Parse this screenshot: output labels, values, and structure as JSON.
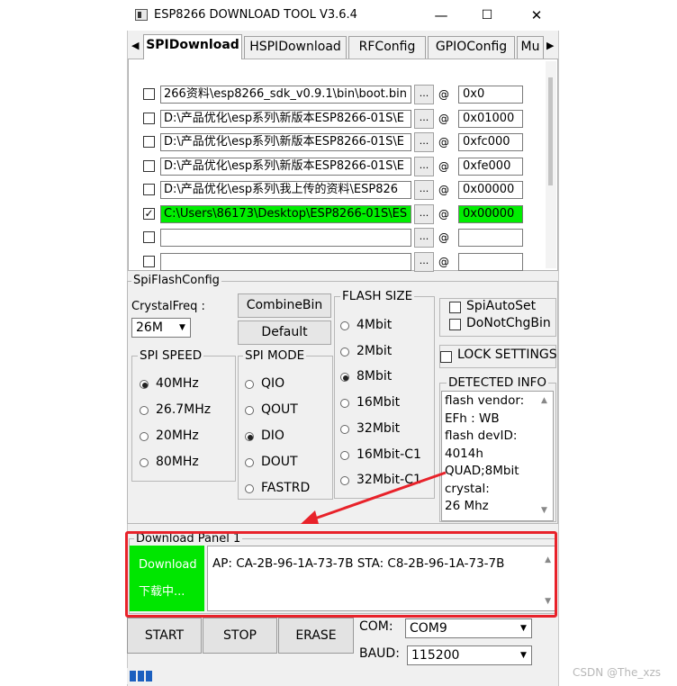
{
  "window": {
    "title": "ESP8266 DOWNLOAD TOOL V3.6.4",
    "minimize": "—",
    "maximize": "☐",
    "close": "✕"
  },
  "tabs": [
    {
      "label": "SPIDownload",
      "active": true
    },
    {
      "label": "HSPIDownload",
      "active": false
    },
    {
      "label": "RFConfig",
      "active": false
    },
    {
      "label": "GPIOConfig",
      "active": false
    },
    {
      "label": "Mu",
      "active": false
    }
  ],
  "files": [
    {
      "checked": false,
      "path": "266资料\\esp8266_sdk_v0.9.1\\bin\\boot.bin",
      "dots": "...",
      "at": "@",
      "addr": "0x0",
      "highlight": false
    },
    {
      "checked": false,
      "path": "D:\\产品优化\\esp系列\\新版本ESP8266-01S\\E",
      "dots": "...",
      "at": "@",
      "addr": "0x01000",
      "highlight": false
    },
    {
      "checked": false,
      "path": "D:\\产品优化\\esp系列\\新版本ESP8266-01S\\E",
      "dots": "...",
      "at": "@",
      "addr": "0xfc000",
      "highlight": false
    },
    {
      "checked": false,
      "path": "D:\\产品优化\\esp系列\\新版本ESP8266-01S\\E",
      "dots": "...",
      "at": "@",
      "addr": "0xfe000",
      "highlight": false
    },
    {
      "checked": false,
      "path": "D:\\产品优化\\esp系列\\我上传的资料\\ESP826",
      "dots": "...",
      "at": "@",
      "addr": "0x00000",
      "highlight": false
    },
    {
      "checked": true,
      "path": "C:\\Users\\86173\\Desktop\\ESP8266-01S\\ES",
      "dots": "...",
      "at": "@",
      "addr": "0x00000",
      "highlight": true
    },
    {
      "checked": false,
      "path": "",
      "dots": "...",
      "at": "@",
      "addr": "",
      "highlight": false
    },
    {
      "checked": false,
      "path": "",
      "dots": "...",
      "at": "@",
      "addr": "",
      "highlight": false
    }
  ],
  "config": {
    "group_label": "SpiFlashConfig",
    "crystal_label": "CrystalFreq :",
    "crystal_value": "26M",
    "combine_bin": "CombineBin",
    "default": "Default",
    "spi_speed_label": "SPI SPEED",
    "spi_speed": [
      {
        "label": "40MHz",
        "on": true
      },
      {
        "label": "26.7MHz",
        "on": false
      },
      {
        "label": "20MHz",
        "on": false
      },
      {
        "label": "80MHz",
        "on": false
      }
    ],
    "spi_mode_label": "SPI MODE",
    "spi_mode": [
      {
        "label": "QIO",
        "on": false
      },
      {
        "label": "QOUT",
        "on": false
      },
      {
        "label": "DIO",
        "on": true
      },
      {
        "label": "DOUT",
        "on": false
      },
      {
        "label": "FASTRD",
        "on": false
      }
    ],
    "flash_size_label": "FLASH SIZE",
    "flash_size": [
      {
        "label": "4Mbit",
        "on": false
      },
      {
        "label": "2Mbit",
        "on": false
      },
      {
        "label": "8Mbit",
        "on": true
      },
      {
        "label": "16Mbit",
        "on": false
      },
      {
        "label": "32Mbit",
        "on": false
      },
      {
        "label": "16Mbit-C1",
        "on": false
      },
      {
        "label": "32Mbit-C1",
        "on": false
      }
    ],
    "spi_auto_set": "SpiAutoSet",
    "do_not_chg_bin": "DoNotChgBin",
    "lock_settings": "LOCK SETTINGS",
    "detected_label": "DETECTED INFO",
    "detected_info": [
      "flash vendor:",
      "EFh : WB",
      "flash devID:",
      "4014h",
      "QUAD;8Mbit",
      "crystal:",
      "26 Mhz"
    ]
  },
  "download": {
    "panel_label": "Download Panel 1",
    "status_line1": "Download",
    "status_line2": "下载中...",
    "info_text": "AP:  CA-2B-96-1A-73-7B  STA:  C8-2B-96-1A-73-7B"
  },
  "controls": {
    "start": "START",
    "stop": "STOP",
    "erase": "ERASE",
    "com_label": "COM:",
    "com_value": "COM9",
    "baud_label": "BAUD:",
    "baud_value": "115200"
  },
  "watermark": "CSDN @The_xzs",
  "colors": {
    "highlight_green": "#00ee00",
    "annotation_red": "#e8222a",
    "progress_blue": "#1b5fbf"
  }
}
